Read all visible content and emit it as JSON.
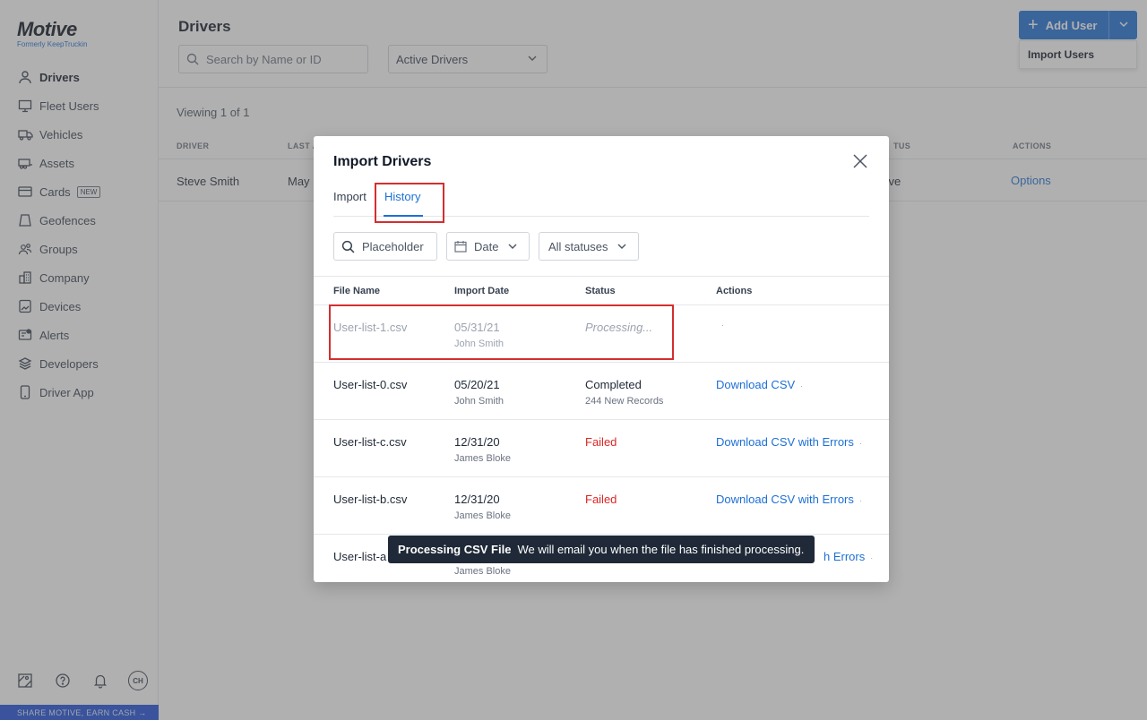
{
  "brand": {
    "name": "Motive",
    "subtitle": "Formerly KeepTruckin"
  },
  "sidebar": {
    "items": [
      {
        "label": "Drivers",
        "icon": "user-icon",
        "active": true
      },
      {
        "label": "Fleet Users",
        "icon": "monitor-icon"
      },
      {
        "label": "Vehicles",
        "icon": "truck-icon"
      },
      {
        "label": "Assets",
        "icon": "trailer-icon"
      },
      {
        "label": "Cards",
        "icon": "card-icon",
        "badge": "NEW"
      },
      {
        "label": "Geofences",
        "icon": "geofence-icon"
      },
      {
        "label": "Groups",
        "icon": "groups-icon"
      },
      {
        "label": "Company",
        "icon": "building-icon"
      },
      {
        "label": "Devices",
        "icon": "device-icon"
      },
      {
        "label": "Alerts",
        "icon": "alert-icon"
      },
      {
        "label": "Developers",
        "icon": "layers-icon"
      },
      {
        "label": "Driver App",
        "icon": "phone-icon"
      }
    ],
    "avatar_initials": "CH",
    "share_text": "SHARE MOTIVE, EARN CASH →"
  },
  "header": {
    "title": "Drivers",
    "search_placeholder": "Search by Name or ID",
    "filter_value": "Active Drivers",
    "add_user_label": "Add User",
    "menu_item": "Import Users"
  },
  "list": {
    "viewing": "Viewing 1 of 1",
    "columns": {
      "driver": "DRIVER",
      "last": "LAST A",
      "status": "TUS",
      "actions": "ACTIONS"
    },
    "row": {
      "driver": "Steve Smith",
      "last": "May",
      "status": "tive",
      "action": "Options"
    }
  },
  "modal": {
    "title": "Import Drivers",
    "tabs": {
      "import": "Import",
      "history": "History"
    },
    "filters": {
      "search_placeholder": "Placeholder",
      "date": "Date",
      "status": "All statuses"
    },
    "columns": {
      "file": "File Name",
      "date": "Import Date",
      "status": "Status",
      "actions": "Actions"
    },
    "rows": [
      {
        "file": "User-list-1.csv",
        "date": "05/31/21",
        "user": "John Smith",
        "status": "Processing...",
        "status_sub": "",
        "action": "",
        "dot": "·"
      },
      {
        "file": "User-list-0.csv",
        "date": "05/20/21",
        "user": "John Smith",
        "status": "Completed",
        "status_sub": "244 New Records",
        "action": "Download CSV",
        "dot": "·"
      },
      {
        "file": "User-list-c.csv",
        "date": "12/31/20",
        "user": "James Bloke",
        "status": "Failed",
        "status_sub": "",
        "action": "Download CSV with Errors",
        "dot": "·"
      },
      {
        "file": "User-list-b.csv",
        "date": "12/31/20",
        "user": "James Bloke",
        "status": "Failed",
        "status_sub": "",
        "action": "Download CSV with Errors",
        "dot": "·"
      },
      {
        "file": "User-list-a",
        "date": "",
        "user": "James Bloke",
        "status": "",
        "status_sub": "",
        "action": "h Errors",
        "dot": "·"
      }
    ]
  },
  "toast": {
    "title": "Processing CSV File",
    "message": "We will email you when the file has finished processing."
  },
  "colors": {
    "accent": "#1d6fd6",
    "failed": "#dc2626",
    "highlight": "#d32f2f",
    "overlay": "rgba(90,90,90,0.48)"
  }
}
